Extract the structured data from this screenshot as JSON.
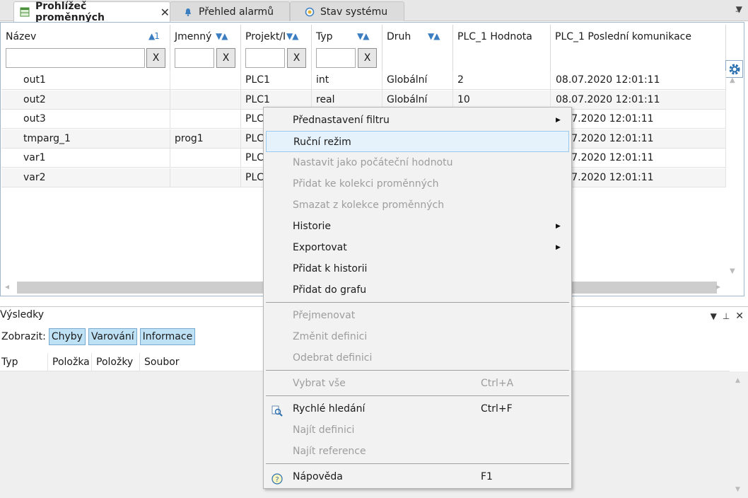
{
  "tabs": [
    {
      "label": "Prohlížeč proměnných",
      "icon": "variable-table-icon",
      "active": true,
      "closable": true
    },
    {
      "label": "Přehled alarmů",
      "icon": "bell-icon",
      "active": false,
      "closable": false
    },
    {
      "label": "Stav systému",
      "icon": "system-status-icon",
      "active": false,
      "closable": false
    }
  ],
  "grid": {
    "columns": [
      {
        "title": "Název",
        "sort": "▲1",
        "has_filter": true
      },
      {
        "title": "Jmenný",
        "sort": "▼▲",
        "has_filter": true
      },
      {
        "title": "Projekt/I",
        "sort": "▼▲",
        "has_filter": true
      },
      {
        "title": "Typ",
        "sort": "▼▲",
        "has_filter": true
      },
      {
        "title": "Druh",
        "sort": "▼▲",
        "has_filter": false
      },
      {
        "title": "PLC_1 Hodnota",
        "sort": "",
        "has_filter": false
      },
      {
        "title": "PLC_1 Poslední komunikace",
        "sort": "",
        "has_filter": false
      }
    ],
    "filter_clear_label": "X",
    "rows": [
      [
        "out1",
        "",
        "PLC1",
        "int",
        "Globální",
        "2",
        "08.07.2020 12:01:11"
      ],
      [
        "out2",
        "",
        "PLC1",
        "real",
        "Globální",
        "10",
        "08.07.2020 12:01:11"
      ],
      [
        "out3",
        "",
        "PLC",
        "",
        "",
        "",
        "8.07.2020 12:01:11"
      ],
      [
        "tmparg_1",
        "prog1",
        "PLC",
        "",
        "",
        "",
        "8.07.2020 12:01:11"
      ],
      [
        "var1",
        "",
        "PLC",
        "",
        "",
        "",
        "8.07.2020 12:01:11"
      ],
      [
        "var2",
        "",
        "PLC",
        "",
        "",
        "",
        "8.07.2020 12:01:11"
      ]
    ]
  },
  "results": {
    "title": "Výsledky",
    "show_label": "Zobrazit:",
    "filters": [
      "Chyby",
      "Varování",
      "Informace"
    ],
    "columns": [
      "Typ",
      "Položka",
      "Položky",
      "Soubor"
    ]
  },
  "context_menu": {
    "items": [
      {
        "label": "Přednastavení filtru",
        "shortcut": "",
        "submenu": true,
        "disabled": false,
        "highlighted": false,
        "icon": ""
      },
      {
        "label": "Ruční režim",
        "shortcut": "",
        "submenu": false,
        "disabled": false,
        "highlighted": true,
        "icon": ""
      },
      {
        "label": "Nastavit jako počáteční hodnotu",
        "shortcut": "",
        "submenu": false,
        "disabled": true,
        "highlighted": false,
        "icon": ""
      },
      {
        "label": "Přidat ke kolekci proměnných",
        "shortcut": "",
        "submenu": false,
        "disabled": true,
        "highlighted": false,
        "icon": ""
      },
      {
        "label": "Smazat z kolekce proměnných",
        "shortcut": "",
        "submenu": false,
        "disabled": true,
        "highlighted": false,
        "icon": ""
      },
      {
        "label": "Historie",
        "shortcut": "",
        "submenu": true,
        "disabled": false,
        "highlighted": false,
        "icon": ""
      },
      {
        "label": "Exportovat",
        "shortcut": "",
        "submenu": true,
        "disabled": false,
        "highlighted": false,
        "icon": ""
      },
      {
        "label": "Přidat k historii",
        "shortcut": "",
        "submenu": false,
        "disabled": false,
        "highlighted": false,
        "icon": ""
      },
      {
        "label": "Přidat do grafu",
        "shortcut": "",
        "submenu": false,
        "disabled": false,
        "highlighted": false,
        "icon": ""
      },
      {
        "separator": true
      },
      {
        "label": "Přejmenovat",
        "shortcut": "",
        "submenu": false,
        "disabled": true,
        "highlighted": false,
        "icon": ""
      },
      {
        "label": "Změnit definici",
        "shortcut": "",
        "submenu": false,
        "disabled": true,
        "highlighted": false,
        "icon": ""
      },
      {
        "label": "Odebrat definici",
        "shortcut": "",
        "submenu": false,
        "disabled": true,
        "highlighted": false,
        "icon": ""
      },
      {
        "separator": true
      },
      {
        "label": "Vybrat vše",
        "shortcut": "Ctrl+A",
        "submenu": false,
        "disabled": true,
        "highlighted": false,
        "icon": ""
      },
      {
        "separator": true
      },
      {
        "label": "Rychlé hledání",
        "shortcut": "Ctrl+F",
        "submenu": false,
        "disabled": false,
        "highlighted": false,
        "icon": "quick-search-icon"
      },
      {
        "label": "Najít definici",
        "shortcut": "",
        "submenu": false,
        "disabled": true,
        "highlighted": false,
        "icon": ""
      },
      {
        "label": "Najít reference",
        "shortcut": "",
        "submenu": false,
        "disabled": true,
        "highlighted": false,
        "icon": ""
      },
      {
        "separator": true
      },
      {
        "label": "Nápověda",
        "shortcut": "F1",
        "submenu": false,
        "disabled": false,
        "highlighted": false,
        "icon": "help-icon"
      }
    ]
  },
  "colors": {
    "accent": "#3a7dc0",
    "chip_bg": "#bfe1f5",
    "highlight_bg": "#e6f2fb",
    "disabled_text": "#9d9d9d"
  }
}
